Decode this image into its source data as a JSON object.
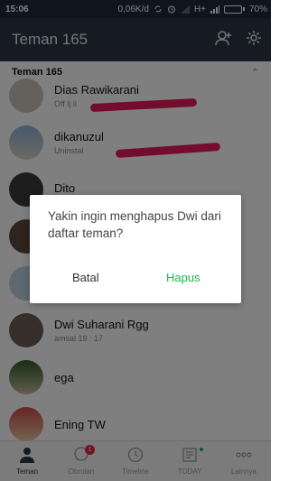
{
  "status_bar": {
    "time": "15:06",
    "network_speed": "0,06K/d",
    "network_type": "H+",
    "battery": "70%",
    "battery_level": 0.7
  },
  "header": {
    "title": "Teman 165",
    "add_friend_icon": "add-user-icon",
    "settings_icon": "gear-icon"
  },
  "friends": {
    "section_title": "Teman 165",
    "items": [
      {
        "name": "Dias Rawikarani",
        "status": "Off lj  li"
      },
      {
        "name": "dikanuzul",
        "status": "Uninstal"
      },
      {
        "name": "Dito",
        "status": ""
      },
      {
        "name": "",
        "status": ""
      },
      {
        "name": "",
        "status": ""
      },
      {
        "name": "Dwi Suharani Rgg",
        "status": "amsal 19 : 17"
      },
      {
        "name": "ega",
        "status": ""
      },
      {
        "name": "Ening TW",
        "status": ""
      }
    ]
  },
  "dialog": {
    "message": "Yakin ingin menghapus Dwi dari daftar teman?",
    "cancel_label": "Batal",
    "confirm_label": "Hapus"
  },
  "bottom_nav": {
    "tabs": [
      {
        "label": "Teman",
        "icon": "person-icon"
      },
      {
        "label": "Obrolan",
        "icon": "chat-icon",
        "badge": "1"
      },
      {
        "label": "Timeline",
        "icon": "clock-icon"
      },
      {
        "label": "TODAY",
        "icon": "news-icon"
      },
      {
        "label": "Lainnya",
        "icon": "more-icon"
      }
    ]
  },
  "colors": {
    "header_bg": "#2b3446",
    "confirm": "#1cb84a",
    "scribble": "#e8195d",
    "badge": "#e0293b"
  }
}
